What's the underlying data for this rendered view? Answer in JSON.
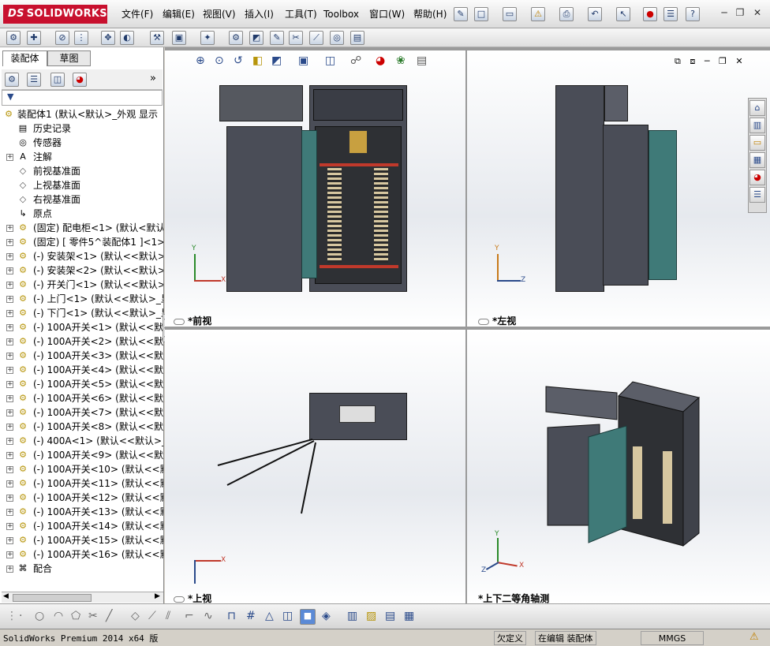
{
  "app": {
    "logo_prefix": "DS",
    "logo_name": "SOLIDWORKS"
  },
  "menu": [
    "文件(F)",
    "编辑(E)",
    "视图(V)",
    "插入(I)",
    "工具(T)",
    "Toolbox",
    "窗口(W)",
    "帮助(H)"
  ],
  "window_controls": {
    "minimize": "─",
    "restore": "❐",
    "close": "✕"
  },
  "tabs": [
    "装配体",
    "草图"
  ],
  "tree": {
    "root": "装配体1  (默认<默认>_外观 显示",
    "items": [
      {
        "label": "历史记录",
        "icon": "history-icon",
        "expand": false
      },
      {
        "label": "传感器",
        "icon": "sensor-icon",
        "expand": false
      },
      {
        "label": "注解",
        "icon": "annotation-icon",
        "expand": true
      },
      {
        "label": "前视基准面",
        "icon": "plane-icon",
        "expand": false
      },
      {
        "label": "上视基准面",
        "icon": "plane-icon",
        "expand": false
      },
      {
        "label": "右视基准面",
        "icon": "plane-icon",
        "expand": false
      },
      {
        "label": "原点",
        "icon": "origin-icon",
        "expand": false
      },
      {
        "label": "(固定) 配电柜<1> (默认<默认",
        "icon": "component-icon",
        "expand": true
      },
      {
        "label": "(固定) [ 零件5^装配体1 ]<1>",
        "icon": "component-icon",
        "expand": true
      },
      {
        "label": "(-) 安装架<1> (默认<<默认>_",
        "icon": "component-icon",
        "expand": true
      },
      {
        "label": "(-) 安装架<2> (默认<<默认>_",
        "icon": "component-icon",
        "expand": true
      },
      {
        "label": "(-) 开关门<1> (默认<<默认>_",
        "icon": "component-icon",
        "expand": true
      },
      {
        "label": "(-) 上门<1> (默认<<默认>_显",
        "icon": "component-icon",
        "expand": true
      },
      {
        "label": "(-) 下门<1> (默认<<默认>_显",
        "icon": "component-icon",
        "expand": true
      },
      {
        "label": "(-) 100A开关<1> (默认<<默认",
        "icon": "component-icon",
        "expand": true
      },
      {
        "label": "(-) 100A开关<2> (默认<<默认",
        "icon": "component-icon",
        "expand": true
      },
      {
        "label": "(-) 100A开关<3> (默认<<默认",
        "icon": "component-icon",
        "expand": true
      },
      {
        "label": "(-) 100A开关<4> (默认<<默认",
        "icon": "component-icon",
        "expand": true
      },
      {
        "label": "(-) 100A开关<5> (默认<<默认",
        "icon": "component-icon",
        "expand": true
      },
      {
        "label": "(-) 100A开关<6> (默认<<默认",
        "icon": "component-icon",
        "expand": true
      },
      {
        "label": "(-) 100A开关<7> (默认<<默认",
        "icon": "component-icon",
        "expand": true
      },
      {
        "label": "(-) 100A开关<8> (默认<<默认",
        "icon": "component-icon",
        "expand": true
      },
      {
        "label": "(-) 400A<1> (默认<<默认>_显",
        "icon": "component-icon",
        "expand": true
      },
      {
        "label": "(-) 100A开关<9> (默认<<默认",
        "icon": "component-icon",
        "expand": true
      },
      {
        "label": "(-) 100A开关<10> (默认<<默认",
        "icon": "component-icon",
        "expand": true
      },
      {
        "label": "(-) 100A开关<11> (默认<<默认",
        "icon": "component-icon",
        "expand": true
      },
      {
        "label": "(-) 100A开关<12> (默认<<默认",
        "icon": "component-icon",
        "expand": true
      },
      {
        "label": "(-) 100A开关<13> (默认<<默认",
        "icon": "component-icon",
        "expand": true
      },
      {
        "label": "(-) 100A开关<14> (默认<<默认",
        "icon": "component-icon",
        "expand": true
      },
      {
        "label": "(-) 100A开关<15> (默认<<默认",
        "icon": "component-icon",
        "expand": true
      },
      {
        "label": "(-) 100A开关<16> (默认<<默认",
        "icon": "component-icon",
        "expand": true
      },
      {
        "label": "配合",
        "icon": "mates-icon",
        "expand": true
      }
    ]
  },
  "views": {
    "front": "*前视",
    "left": "*左视",
    "top": "*上视",
    "iso": "*上下二等角轴测"
  },
  "axes": {
    "x": "X",
    "y": "Y",
    "z": "Z"
  },
  "status": {
    "version": "SolidWorks Premium 2014 x64 版",
    "defined": "欠定义",
    "editing": "在编辑 装配体",
    "units": "MMGS"
  },
  "colors": {
    "accent": "#c8102e",
    "door": "#3f7a78",
    "cabinet": "#4a4d57"
  }
}
